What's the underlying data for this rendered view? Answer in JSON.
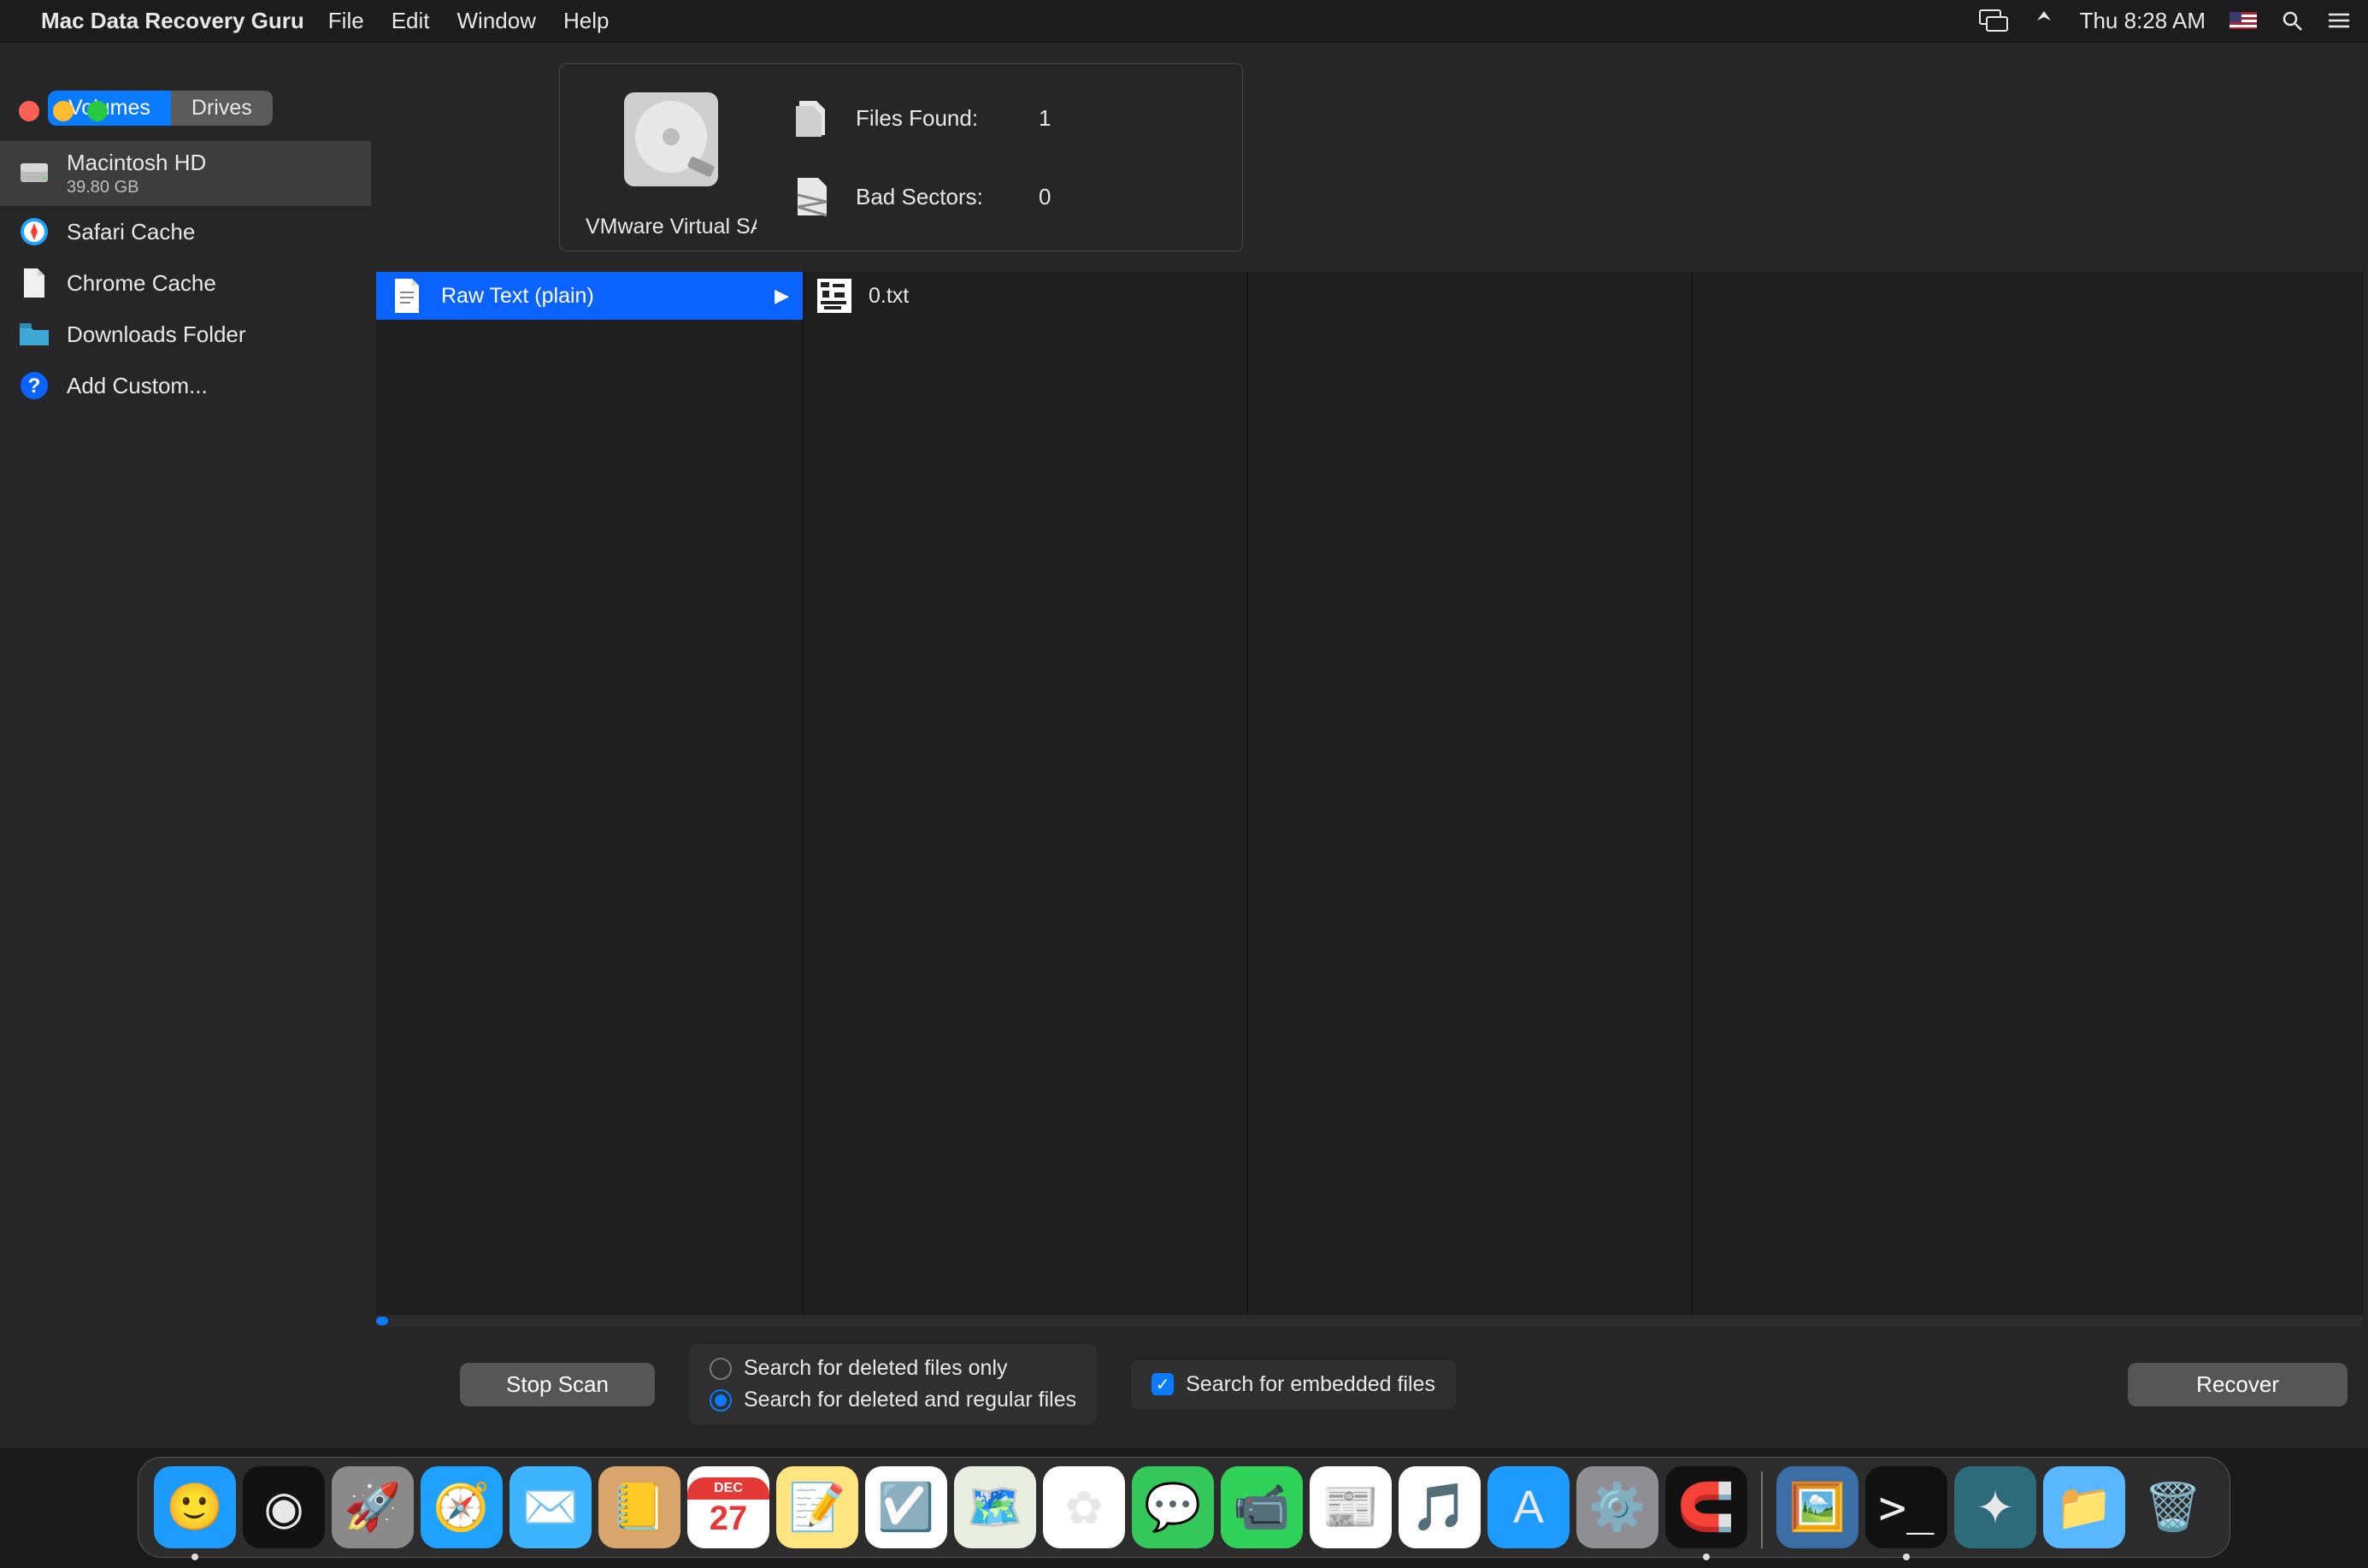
{
  "menubar": {
    "app_name": "Mac Data Recovery Guru",
    "items": [
      "File",
      "Edit",
      "Window",
      "Help"
    ],
    "clock": "Thu 8:28 AM"
  },
  "sidebar": {
    "tabs": {
      "volumes": "Volumes",
      "drives": "Drives",
      "active": "volumes"
    },
    "items": [
      {
        "label": "Macintosh HD",
        "sub": "39.80 GB",
        "icon": "hdd-icon",
        "selected": true
      },
      {
        "label": "Safari Cache",
        "icon": "safari-icon"
      },
      {
        "label": "Chrome Cache",
        "icon": "file-icon"
      },
      {
        "label": "Downloads Folder",
        "icon": "folder-icon"
      },
      {
        "label": "Add Custom...",
        "icon": "help-icon"
      }
    ]
  },
  "header": {
    "drive_label": "VMware Virtual SATA H",
    "files_found_label": "Files Found:",
    "files_found_value": "1",
    "bad_sectors_label": "Bad Sectors:",
    "bad_sectors_value": "0"
  },
  "columns": {
    "col1": [
      {
        "label": "Raw Text (plain)",
        "icon": "text-file-icon",
        "selected": true,
        "has_children": true
      }
    ],
    "col2": [
      {
        "label": "0.txt",
        "icon": "noise-file-icon"
      }
    ]
  },
  "bottom": {
    "stop_scan": "Stop Scan",
    "recover": "Recover",
    "radio_deleted_only": "Search for deleted files only",
    "radio_deleted_regular": "Search for deleted and regular files",
    "radio_selected": "deleted_regular",
    "check_embedded": "Search for embedded files",
    "check_embedded_checked": true
  },
  "dock": {
    "items": [
      {
        "name": "finder",
        "running": true,
        "bg": "#1e9bff",
        "glyph": "🙂"
      },
      {
        "name": "siri",
        "bg": "#111",
        "glyph": "◉"
      },
      {
        "name": "launchpad",
        "bg": "#8a8a8a",
        "glyph": "🚀"
      },
      {
        "name": "safari",
        "bg": "#1fa2ff",
        "glyph": "🧭"
      },
      {
        "name": "mail",
        "bg": "#3cb4ff",
        "glyph": "✉️"
      },
      {
        "name": "contacts",
        "bg": "#d9a56d",
        "glyph": "📒"
      },
      {
        "name": "calendar",
        "bg": "#fff",
        "glyph": "27"
      },
      {
        "name": "notes",
        "bg": "#ffe57f",
        "glyph": "📝"
      },
      {
        "name": "reminders",
        "bg": "#fff",
        "glyph": "☑️"
      },
      {
        "name": "maps",
        "bg": "#e8efe0",
        "glyph": "🗺️"
      },
      {
        "name": "photos",
        "bg": "#fff",
        "glyph": "✿"
      },
      {
        "name": "messages",
        "bg": "#34c759",
        "glyph": "💬"
      },
      {
        "name": "facetime",
        "bg": "#30d158",
        "glyph": "📹"
      },
      {
        "name": "news",
        "bg": "#fff",
        "glyph": "📰"
      },
      {
        "name": "music",
        "bg": "#fff",
        "glyph": "🎵"
      },
      {
        "name": "appstore",
        "bg": "#1e9bff",
        "glyph": "A"
      },
      {
        "name": "settings",
        "bg": "#8e8e93",
        "glyph": "⚙️"
      },
      {
        "name": "recovery-guru",
        "running": true,
        "bg": "#111",
        "glyph": "🧲"
      }
    ],
    "right_items": [
      {
        "name": "preview",
        "bg": "#3a6ea5",
        "glyph": "🖼️"
      },
      {
        "name": "terminal",
        "running": true,
        "bg": "#111",
        "glyph": ">_"
      },
      {
        "name": "unknown-app",
        "bg": "#2d6b7a",
        "glyph": "✦"
      },
      {
        "name": "downloads-stack",
        "bg": "#59b7ff",
        "glyph": "📁"
      },
      {
        "name": "trash",
        "bg": "transparent",
        "glyph": "🗑️"
      }
    ]
  }
}
